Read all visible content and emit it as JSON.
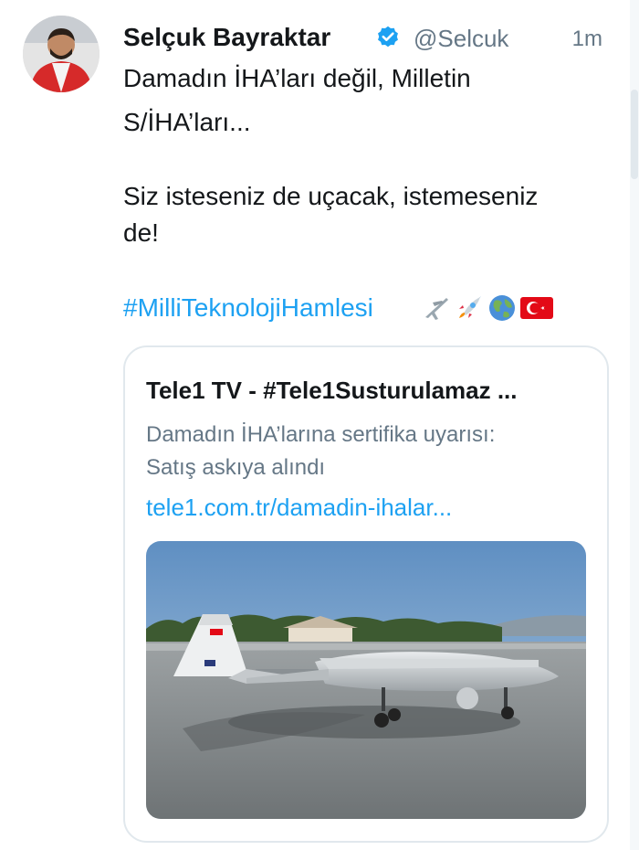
{
  "tweet": {
    "author_name": "Selçuk Bayraktar",
    "handle": "@Selcuk",
    "time": "1m",
    "text_lines": [
      "Damadın İHA’ları değil, Milletin",
      "S/İHA’ları...",
      "Siz isteseniz de uçacak, istemeseniz",
      "de!"
    ],
    "hashtag": "#MilliTeknolojiHamlesi",
    "emojis": [
      "airplane-icon",
      "rocket-icon",
      "globe-icon",
      "turkey-flag-icon"
    ]
  },
  "card": {
    "title": "Tele1 TV - #Tele1Susturulamaz ...",
    "description_lines": [
      "Damadın İHA’larına sertifika uyarısı:",
      "Satış askıya alındı"
    ],
    "link": "tele1.com.tr/damadin-ihalar..."
  },
  "colors": {
    "link_blue": "#1da1f2",
    "verified_blue": "#1da1f2",
    "secondary_text": "#657786",
    "border": "#e1e8ed"
  }
}
